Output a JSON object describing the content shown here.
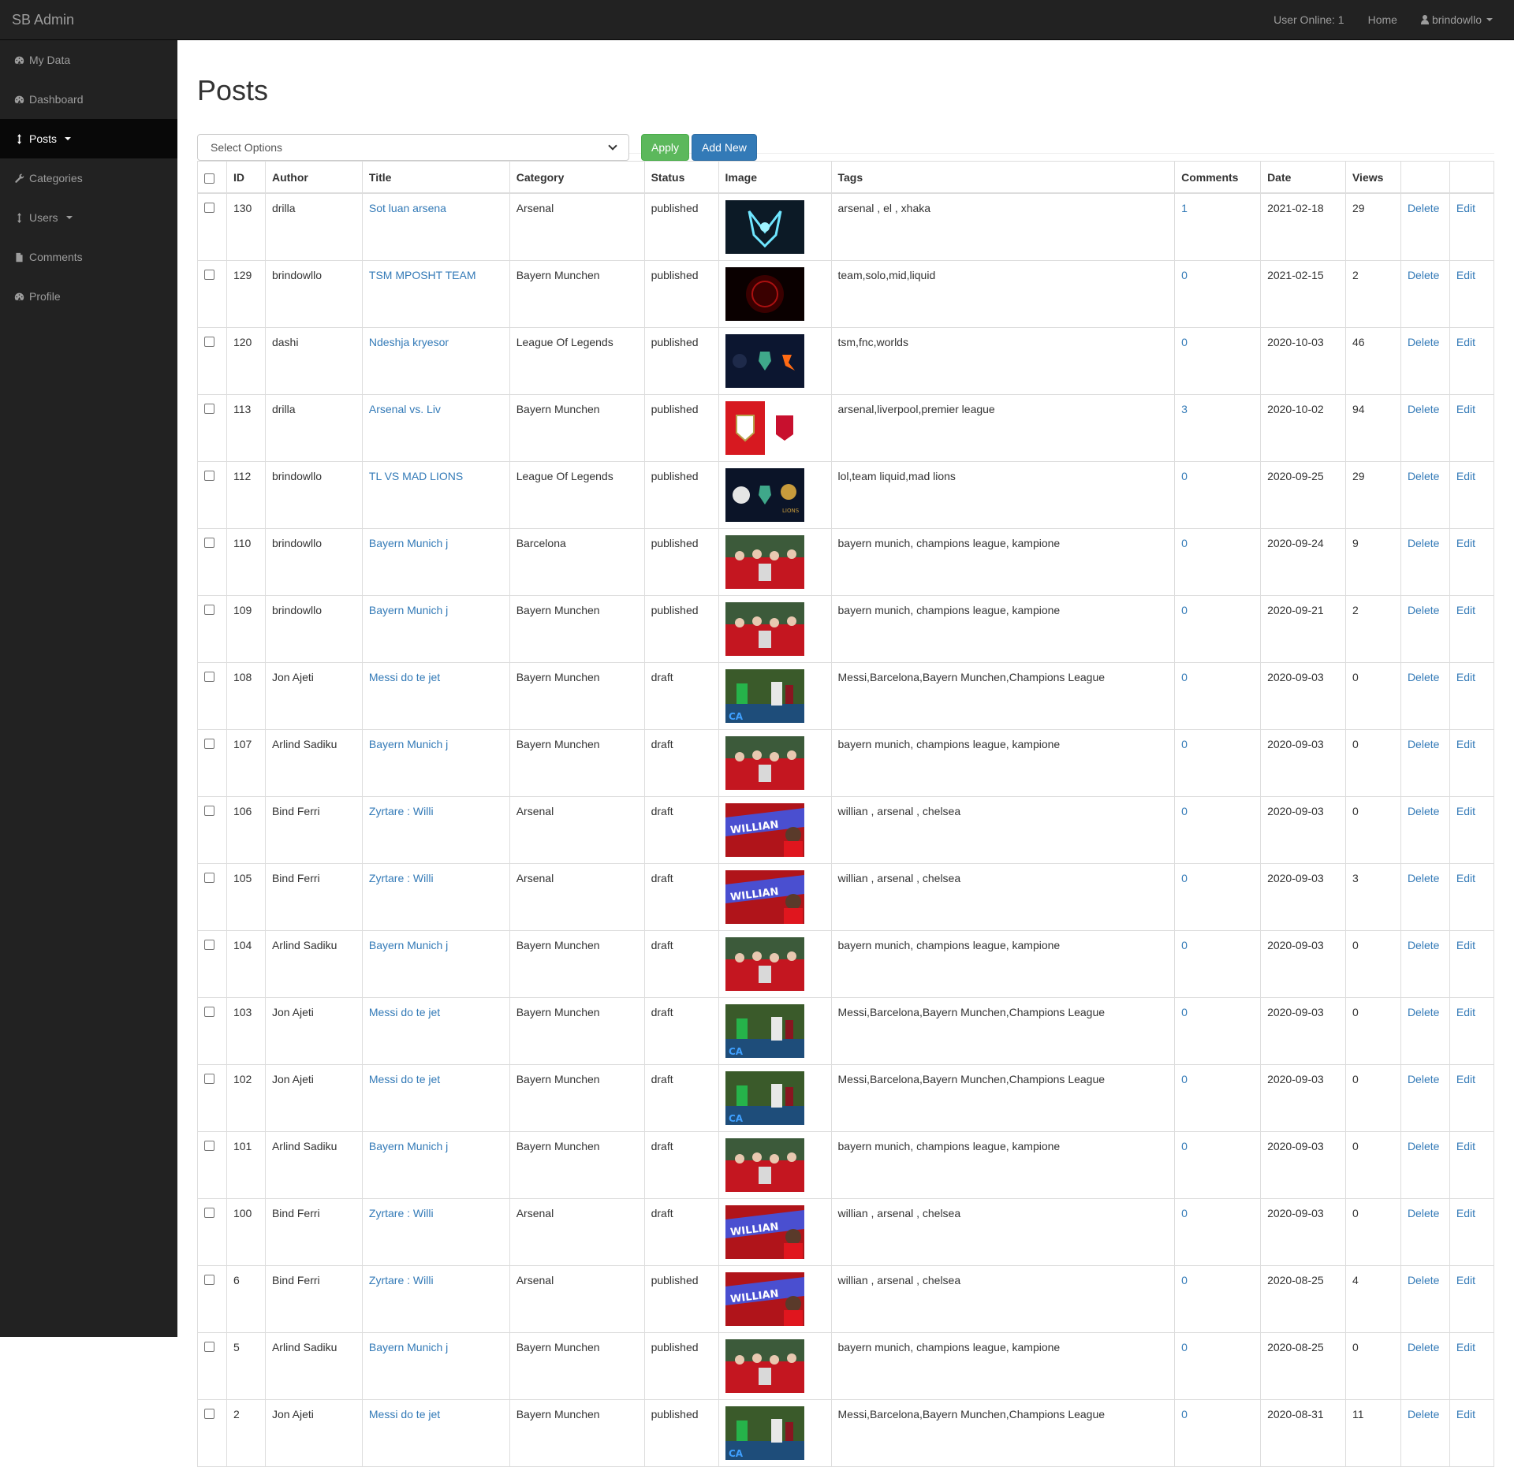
{
  "header": {
    "brand": "SB Admin",
    "users_online": "User Online: 1",
    "home": "Home",
    "username": "brindowllo"
  },
  "sidebar": {
    "items": [
      {
        "label": "My Data",
        "icon": "dashboard-icon"
      },
      {
        "label": "Dashboard",
        "icon": "dashboard-icon"
      },
      {
        "label": "Posts",
        "icon": "arrows-v-icon",
        "active": true,
        "dropdown": true
      },
      {
        "label": "Categories",
        "icon": "wrench-icon"
      },
      {
        "label": "Users",
        "icon": "arrows-v-icon",
        "dropdown": true
      },
      {
        "label": "Comments",
        "icon": "file-icon"
      },
      {
        "label": "Profile",
        "icon": "dashboard-icon"
      }
    ]
  },
  "main": {
    "title": "Posts",
    "bulk_select": "Select Options",
    "apply_label": "Apply",
    "add_new_label": "Add New",
    "columns": [
      "ID",
      "Author",
      "Title",
      "Category",
      "Status",
      "Image",
      "Tags",
      "Comments",
      "Date",
      "Views",
      "",
      ""
    ],
    "rows": [
      {
        "id": "130",
        "author": "drilla",
        "title": "Sot luan arsena",
        "category": "Arsenal",
        "status": "published",
        "image": "g2-logo",
        "tags": "arsenal , el , xhaka",
        "comments": "1",
        "date": "2021-02-18",
        "views": "29"
      },
      {
        "id": "129",
        "author": "brindowllo",
        "title": "TSM MPOSHT TEAM",
        "category": "Bayern Munchen",
        "status": "published",
        "image": "dark-red",
        "tags": "team,solo,mid,liquid",
        "comments": "0",
        "date": "2021-02-15",
        "views": "2"
      },
      {
        "id": "120",
        "author": "dashi",
        "title": "Ndeshja kryesor",
        "category": "League Of Legends",
        "status": "published",
        "image": "tsm-fnc",
        "tags": "tsm,fnc,worlds",
        "comments": "0",
        "date": "2020-10-03",
        "views": "46"
      },
      {
        "id": "113",
        "author": "drilla",
        "title": "Arsenal vs. Liv",
        "category": "Bayern Munchen",
        "status": "published",
        "image": "ars-liv",
        "tags": "arsenal,liverpool,premier league",
        "comments": "3",
        "date": "2020-10-02",
        "views": "94"
      },
      {
        "id": "112",
        "author": "brindowllo",
        "title": "TL VS MAD LIONS",
        "category": "League Of Legends",
        "status": "published",
        "image": "tl-mad",
        "tags": "lol,team liquid,mad lions",
        "comments": "0",
        "date": "2020-09-25",
        "views": "29"
      },
      {
        "id": "110",
        "author": "brindowllo",
        "title": "Bayern Munich j",
        "category": "Barcelona",
        "status": "published",
        "image": "bayern",
        "tags": "bayern munich, champions league, kampione",
        "comments": "0",
        "date": "2020-09-24",
        "views": "9"
      },
      {
        "id": "109",
        "author": "brindowllo",
        "title": "Bayern Munich j",
        "category": "Bayern Munchen",
        "status": "published",
        "image": "bayern",
        "tags": "bayern munich, champions league, kampione",
        "comments": "0",
        "date": "2020-09-21",
        "views": "2"
      },
      {
        "id": "108",
        "author": "Jon Ajeti",
        "title": "Messi do te jet",
        "category": "Bayern Munchen",
        "status": "draft",
        "image": "messi",
        "tags": "Messi,Barcelona,Bayern Munchen,Champions League",
        "comments": "0",
        "date": "2020-09-03",
        "views": "0"
      },
      {
        "id": "107",
        "author": "Arlind Sadiku",
        "title": "Bayern Munich j",
        "category": "Bayern Munchen",
        "status": "draft",
        "image": "bayern",
        "tags": "bayern munich, champions league, kampione",
        "comments": "0",
        "date": "2020-09-03",
        "views": "0"
      },
      {
        "id": "106",
        "author": "Bind Ferri",
        "title": "Zyrtare : Willi",
        "category": "Arsenal",
        "status": "draft",
        "image": "willian",
        "tags": "willian , arsenal , chelsea",
        "comments": "0",
        "date": "2020-09-03",
        "views": "0"
      },
      {
        "id": "105",
        "author": "Bind Ferri",
        "title": "Zyrtare : Willi",
        "category": "Arsenal",
        "status": "draft",
        "image": "willian",
        "tags": "willian , arsenal , chelsea",
        "comments": "0",
        "date": "2020-09-03",
        "views": "3"
      },
      {
        "id": "104",
        "author": "Arlind Sadiku",
        "title": "Bayern Munich j",
        "category": "Bayern Munchen",
        "status": "draft",
        "image": "bayern",
        "tags": "bayern munich, champions league, kampione",
        "comments": "0",
        "date": "2020-09-03",
        "views": "0"
      },
      {
        "id": "103",
        "author": "Jon Ajeti",
        "title": "Messi do te jet",
        "category": "Bayern Munchen",
        "status": "draft",
        "image": "messi",
        "tags": "Messi,Barcelona,Bayern Munchen,Champions League",
        "comments": "0",
        "date": "2020-09-03",
        "views": "0"
      },
      {
        "id": "102",
        "author": "Jon Ajeti",
        "title": "Messi do te jet",
        "category": "Bayern Munchen",
        "status": "draft",
        "image": "messi",
        "tags": "Messi,Barcelona,Bayern Munchen,Champions League",
        "comments": "0",
        "date": "2020-09-03",
        "views": "0"
      },
      {
        "id": "101",
        "author": "Arlind Sadiku",
        "title": "Bayern Munich j",
        "category": "Bayern Munchen",
        "status": "draft",
        "image": "bayern",
        "tags": "bayern munich, champions league, kampione",
        "comments": "0",
        "date": "2020-09-03",
        "views": "0"
      },
      {
        "id": "100",
        "author": "Bind Ferri",
        "title": "Zyrtare : Willi",
        "category": "Arsenal",
        "status": "draft",
        "image": "willian",
        "tags": "willian , arsenal , chelsea",
        "comments": "0",
        "date": "2020-09-03",
        "views": "0"
      },
      {
        "id": "6",
        "author": "Bind Ferri",
        "title": "Zyrtare : Willi",
        "category": "Arsenal",
        "status": "published",
        "image": "willian",
        "tags": "willian , arsenal , chelsea",
        "comments": "0",
        "date": "2020-08-25",
        "views": "4"
      },
      {
        "id": "5",
        "author": "Arlind Sadiku",
        "title": "Bayern Munich j",
        "category": "Bayern Munchen",
        "status": "published",
        "image": "bayern",
        "tags": "bayern munich, champions league, kampione",
        "comments": "0",
        "date": "2020-08-25",
        "views": "0"
      },
      {
        "id": "2",
        "author": "Jon Ajeti",
        "title": "Messi do te jet",
        "category": "Bayern Munchen",
        "status": "published",
        "image": "messi",
        "tags": "Messi,Barcelona,Bayern Munchen,Champions League",
        "comments": "0",
        "date": "2020-08-31",
        "views": "11"
      }
    ],
    "delete_label": "Delete",
    "edit_label": "Edit"
  },
  "colors": {
    "topbar": "#222222",
    "sidebar_active": "#080808",
    "link": "#337ab7",
    "success": "#5cb85c",
    "primary": "#337ab7"
  }
}
